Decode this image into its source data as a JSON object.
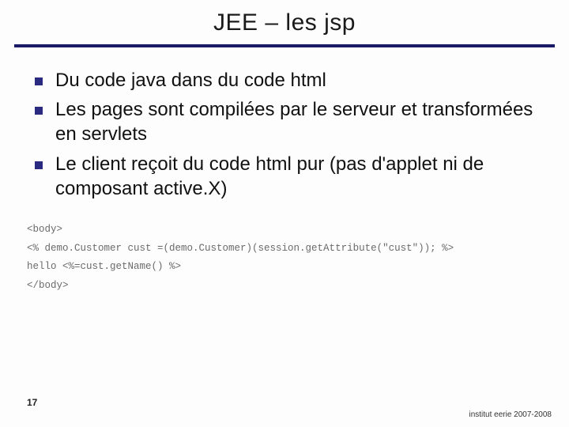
{
  "title": "JEE – les jsp",
  "bullets": [
    "Du code java dans du code html",
    "Les pages sont compilées par le serveur et transformées en servlets",
    "Le client reçoit du code html pur (pas d'applet ni de composant active.X)"
  ],
  "code": {
    "line1": "<body>",
    "line2": "<% demo.Customer cust =(demo.Customer)(session.getAttribute(\"cust\")); %>",
    "line3": "hello <%=cust.getName() %>",
    "line4": "</body>"
  },
  "pageNumber": "17",
  "footer": "institut eerie 2007-2008"
}
